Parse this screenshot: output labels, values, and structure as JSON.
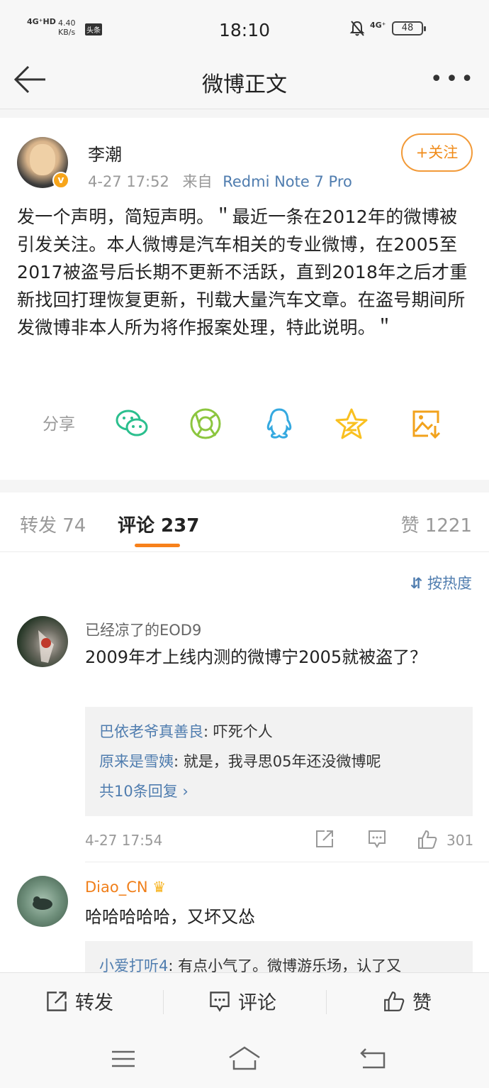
{
  "status_bar": {
    "network": "4G⁺HD",
    "speed_value": "4.40",
    "speed_unit": "KB/s",
    "app_badge": "头条",
    "time": "18:10",
    "network2": "4G⁺",
    "battery": "48"
  },
  "header": {
    "title": "微博正文"
  },
  "post": {
    "author": "李潮",
    "verified_mark": "v",
    "date": "4-27 17:52",
    "source_prefix": "来自",
    "source": "Redmi Note 7 Pro",
    "follow_label": "+关注",
    "content": "发一个声明，简短声明。＂最近一条在2012年的微博被引发关注。本人微博是汽车相关的专业微博，在2005至2017被盗号后长期不更新不活跃，直到2018年之后才重新找回打理恢复更新，刊载大量汽车文章。在盗号期间所发微博非本人所为将作报案处理，特此说明。＂",
    "share_label": "分享",
    "share_icons": [
      "wechat-icon",
      "moments-icon",
      "qq-icon",
      "qzone-icon",
      "save-image-icon"
    ]
  },
  "tabs": {
    "repost": "转发 74",
    "comment": "评论 237",
    "like": "赞 1221"
  },
  "comments": {
    "sort_label": "按热度",
    "items": [
      {
        "name": "已经凉了的EOD9",
        "text": "2009年才上线内测的微博宁2005就被盗了？",
        "replies": [
          {
            "name": "巴依老爷真善良",
            "text": ": 吓死个人"
          },
          {
            "name": "原来是雪姨",
            "text": ": 就是，我寻思05年还没微博呢"
          }
        ],
        "more_replies": "共10条回复 ›",
        "time": "4-27 17:54",
        "likes": "301"
      },
      {
        "name": "Diao_CN",
        "text": "哈哈哈哈哈，又坏又怂",
        "replies": [
          {
            "name": "小爱打听4",
            "text": ": 有点小气了。微博游乐场，认了又"
          }
        ]
      }
    ]
  },
  "action_bar": {
    "repost": "转发",
    "comment": "评论",
    "like": "赞"
  },
  "colors": {
    "accent_orange": "#f7811b",
    "link_blue": "#507daf",
    "wechat_green": "#2bbf8e",
    "moments_green": "#8cc63f",
    "qq_blue": "#35a9e0",
    "qzone_yellow": "#f9c020"
  }
}
